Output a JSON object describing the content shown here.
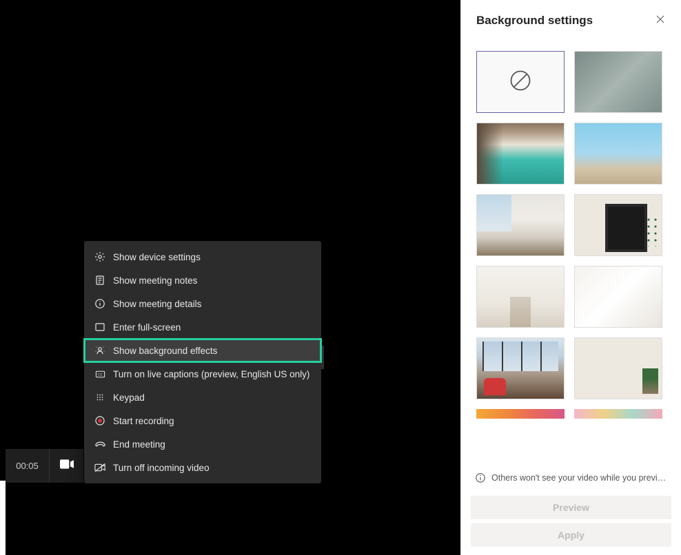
{
  "bottom_bar": {
    "timer": "00:05"
  },
  "context_menu": {
    "items": [
      {
        "icon": "gear-icon",
        "label": "Show device settings"
      },
      {
        "icon": "notes-icon",
        "label": "Show meeting notes"
      },
      {
        "icon": "info-icon",
        "label": "Show meeting details"
      },
      {
        "icon": "fullscreen-icon",
        "label": "Enter full-screen"
      },
      {
        "icon": "background-effects-icon",
        "label": "Show background effects",
        "highlighted": true
      },
      {
        "icon": "captions-icon",
        "label": "Turn on live captions (preview, English US only)"
      },
      {
        "icon": "keypad-icon",
        "label": "Keypad"
      },
      {
        "icon": "record-icon",
        "label": "Start recording"
      },
      {
        "icon": "end-call-icon",
        "label": "End meeting"
      },
      {
        "icon": "video-off-icon",
        "label": "Turn off incoming video"
      }
    ]
  },
  "side_panel": {
    "title": "Background settings",
    "backgrounds": [
      {
        "name": "none",
        "selected": true
      },
      {
        "name": "blur"
      },
      {
        "name": "office-lockers"
      },
      {
        "name": "beach"
      },
      {
        "name": "loft-window"
      },
      {
        "name": "room-mirror"
      },
      {
        "name": "white-staircase"
      },
      {
        "name": "white-studio"
      },
      {
        "name": "lounge-windows"
      },
      {
        "name": "minimal-room"
      },
      {
        "name": "gradient-orange"
      },
      {
        "name": "gradient-pastel"
      }
    ],
    "info_text": "Others won't see your video while you previe...",
    "preview_button": "Preview",
    "apply_button": "Apply"
  }
}
